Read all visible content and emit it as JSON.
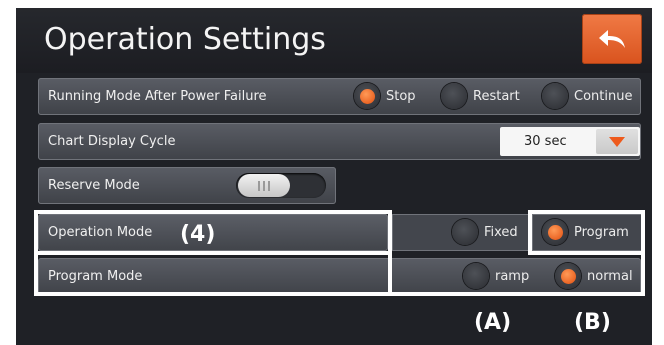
{
  "page_title": "Operation Settings",
  "rows": {
    "power_failure": {
      "label": "Running Mode After Power Failure",
      "options": [
        {
          "label": "Stop",
          "selected": true
        },
        {
          "label": "Restart",
          "selected": false
        },
        {
          "label": "Continue",
          "selected": false
        }
      ]
    },
    "chart_cycle": {
      "label": "Chart Display Cycle",
      "value": "30 sec"
    },
    "reserve_mode": {
      "label": "Reserve Mode",
      "enabled": false
    },
    "operation_mode": {
      "label": "Operation Mode",
      "options": [
        {
          "label": "Fixed",
          "selected": false
        },
        {
          "label": "Program",
          "selected": true
        }
      ]
    },
    "program_mode": {
      "label": "Program Mode",
      "options": [
        {
          "label": "ramp",
          "selected": false
        },
        {
          "label": "normal",
          "selected": true
        }
      ]
    }
  },
  "annotations": {
    "four": "(4)",
    "a": "(A)",
    "b": "(B)"
  },
  "colors": {
    "accent": "#e8642e",
    "background": "#1f2126",
    "row": "#4a4d54"
  }
}
